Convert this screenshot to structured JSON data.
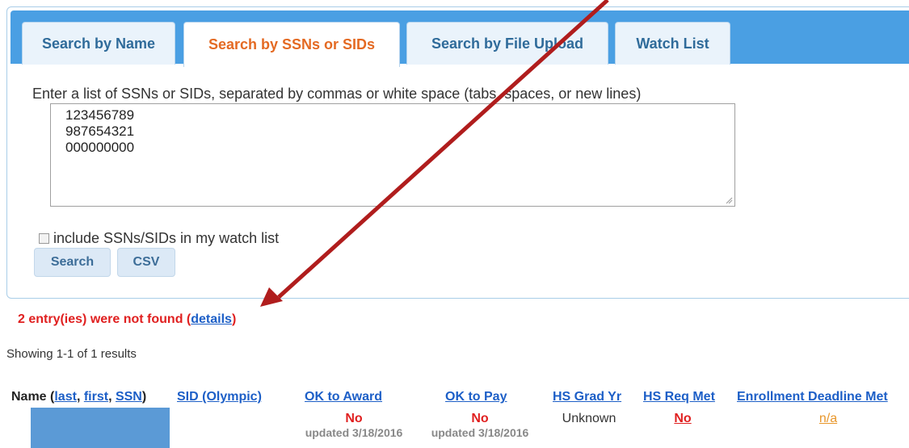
{
  "tabs": [
    {
      "label": "Search by Name"
    },
    {
      "label": "Search by SSNs or SIDs"
    },
    {
      "label": "Search by File Upload"
    },
    {
      "label": "Watch List"
    }
  ],
  "form": {
    "instructions": "Enter a list of SSNs or SIDs, separated by commas or white space (tabs, spaces, or new lines)",
    "ssn_text": "123456789\n987654321\n000000000",
    "watchlist_label": "include SSNs/SIDs in my watch list",
    "search_button": "Search",
    "csv_button": "CSV"
  },
  "not_found": {
    "prefix": "2 entry(ies) were not found (",
    "link": "details",
    "suffix": ")"
  },
  "showing": "Showing 1-1 of 1 results",
  "table": {
    "name_header": "Name (",
    "name_links": [
      "last",
      "first",
      "SSN"
    ],
    "name_close": ")",
    "headers": [
      "SID (Olympic)",
      "OK to Award",
      "OK to Pay",
      "HS Grad Yr",
      "HS Req Met",
      "Enrollment Deadline Met"
    ],
    "row": {
      "ok_award": "No",
      "ok_award_updated": "updated 3/18/2016",
      "ok_pay": "No",
      "ok_pay_updated": "updated 3/18/2016",
      "hs_grad_yr": "Unknown",
      "hs_req_met": "No",
      "enrollment": "n/a"
    }
  },
  "colors": {
    "accent": "#e46a23",
    "tabbar": "#4a9fe3",
    "error": "#e02020",
    "link": "#1d5fc7",
    "arrow": "#b01d1d"
  }
}
